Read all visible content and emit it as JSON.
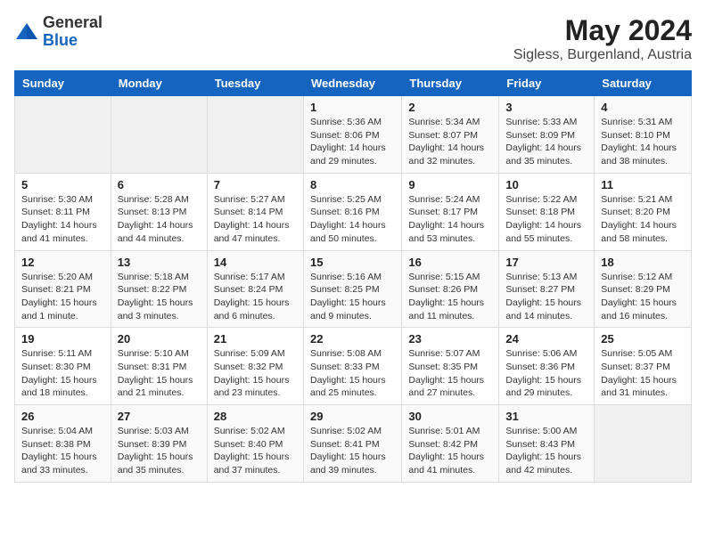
{
  "header": {
    "logo_general": "General",
    "logo_blue": "Blue",
    "month_year": "May 2024",
    "location": "Sigless, Burgenland, Austria"
  },
  "days_of_week": [
    "Sunday",
    "Monday",
    "Tuesday",
    "Wednesday",
    "Thursday",
    "Friday",
    "Saturday"
  ],
  "weeks": [
    [
      {
        "num": "",
        "detail": ""
      },
      {
        "num": "",
        "detail": ""
      },
      {
        "num": "",
        "detail": ""
      },
      {
        "num": "1",
        "detail": "Sunrise: 5:36 AM\nSunset: 8:06 PM\nDaylight: 14 hours\nand 29 minutes."
      },
      {
        "num": "2",
        "detail": "Sunrise: 5:34 AM\nSunset: 8:07 PM\nDaylight: 14 hours\nand 32 minutes."
      },
      {
        "num": "3",
        "detail": "Sunrise: 5:33 AM\nSunset: 8:09 PM\nDaylight: 14 hours\nand 35 minutes."
      },
      {
        "num": "4",
        "detail": "Sunrise: 5:31 AM\nSunset: 8:10 PM\nDaylight: 14 hours\nand 38 minutes."
      }
    ],
    [
      {
        "num": "5",
        "detail": "Sunrise: 5:30 AM\nSunset: 8:11 PM\nDaylight: 14 hours\nand 41 minutes."
      },
      {
        "num": "6",
        "detail": "Sunrise: 5:28 AM\nSunset: 8:13 PM\nDaylight: 14 hours\nand 44 minutes."
      },
      {
        "num": "7",
        "detail": "Sunrise: 5:27 AM\nSunset: 8:14 PM\nDaylight: 14 hours\nand 47 minutes."
      },
      {
        "num": "8",
        "detail": "Sunrise: 5:25 AM\nSunset: 8:16 PM\nDaylight: 14 hours\nand 50 minutes."
      },
      {
        "num": "9",
        "detail": "Sunrise: 5:24 AM\nSunset: 8:17 PM\nDaylight: 14 hours\nand 53 minutes."
      },
      {
        "num": "10",
        "detail": "Sunrise: 5:22 AM\nSunset: 8:18 PM\nDaylight: 14 hours\nand 55 minutes."
      },
      {
        "num": "11",
        "detail": "Sunrise: 5:21 AM\nSunset: 8:20 PM\nDaylight: 14 hours\nand 58 minutes."
      }
    ],
    [
      {
        "num": "12",
        "detail": "Sunrise: 5:20 AM\nSunset: 8:21 PM\nDaylight: 15 hours\nand 1 minute."
      },
      {
        "num": "13",
        "detail": "Sunrise: 5:18 AM\nSunset: 8:22 PM\nDaylight: 15 hours\nand 3 minutes."
      },
      {
        "num": "14",
        "detail": "Sunrise: 5:17 AM\nSunset: 8:24 PM\nDaylight: 15 hours\nand 6 minutes."
      },
      {
        "num": "15",
        "detail": "Sunrise: 5:16 AM\nSunset: 8:25 PM\nDaylight: 15 hours\nand 9 minutes."
      },
      {
        "num": "16",
        "detail": "Sunrise: 5:15 AM\nSunset: 8:26 PM\nDaylight: 15 hours\nand 11 minutes."
      },
      {
        "num": "17",
        "detail": "Sunrise: 5:13 AM\nSunset: 8:27 PM\nDaylight: 15 hours\nand 14 minutes."
      },
      {
        "num": "18",
        "detail": "Sunrise: 5:12 AM\nSunset: 8:29 PM\nDaylight: 15 hours\nand 16 minutes."
      }
    ],
    [
      {
        "num": "19",
        "detail": "Sunrise: 5:11 AM\nSunset: 8:30 PM\nDaylight: 15 hours\nand 18 minutes."
      },
      {
        "num": "20",
        "detail": "Sunrise: 5:10 AM\nSunset: 8:31 PM\nDaylight: 15 hours\nand 21 minutes."
      },
      {
        "num": "21",
        "detail": "Sunrise: 5:09 AM\nSunset: 8:32 PM\nDaylight: 15 hours\nand 23 minutes."
      },
      {
        "num": "22",
        "detail": "Sunrise: 5:08 AM\nSunset: 8:33 PM\nDaylight: 15 hours\nand 25 minutes."
      },
      {
        "num": "23",
        "detail": "Sunrise: 5:07 AM\nSunset: 8:35 PM\nDaylight: 15 hours\nand 27 minutes."
      },
      {
        "num": "24",
        "detail": "Sunrise: 5:06 AM\nSunset: 8:36 PM\nDaylight: 15 hours\nand 29 minutes."
      },
      {
        "num": "25",
        "detail": "Sunrise: 5:05 AM\nSunset: 8:37 PM\nDaylight: 15 hours\nand 31 minutes."
      }
    ],
    [
      {
        "num": "26",
        "detail": "Sunrise: 5:04 AM\nSunset: 8:38 PM\nDaylight: 15 hours\nand 33 minutes."
      },
      {
        "num": "27",
        "detail": "Sunrise: 5:03 AM\nSunset: 8:39 PM\nDaylight: 15 hours\nand 35 minutes."
      },
      {
        "num": "28",
        "detail": "Sunrise: 5:02 AM\nSunset: 8:40 PM\nDaylight: 15 hours\nand 37 minutes."
      },
      {
        "num": "29",
        "detail": "Sunrise: 5:02 AM\nSunset: 8:41 PM\nDaylight: 15 hours\nand 39 minutes."
      },
      {
        "num": "30",
        "detail": "Sunrise: 5:01 AM\nSunset: 8:42 PM\nDaylight: 15 hours\nand 41 minutes."
      },
      {
        "num": "31",
        "detail": "Sunrise: 5:00 AM\nSunset: 8:43 PM\nDaylight: 15 hours\nand 42 minutes."
      },
      {
        "num": "",
        "detail": ""
      }
    ]
  ]
}
